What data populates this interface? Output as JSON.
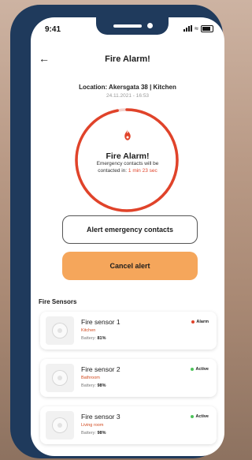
{
  "status_bar": {
    "time": "9:41"
  },
  "header": {
    "back_glyph": "←",
    "title": "Fire Alarm!"
  },
  "location": {
    "text": "Location: Akersgata 38 | Kitchen",
    "timestamp": "24.11.2021 - 16:53"
  },
  "alarm": {
    "title": "Fire Alarm!",
    "message": "Emergency contacts will be contacted in:",
    "countdown": "1 min 23 sec",
    "icon": "flame-icon",
    "progress_fraction": 0.97
  },
  "buttons": {
    "alert_label": "Alert emergency contacts",
    "cancel_label": "Cancel alert"
  },
  "sensors": {
    "section_title": "Fire Sensors",
    "battery_label": "Battery:",
    "items": [
      {
        "name": "Fire sensor 1",
        "room": "Kitchen",
        "battery": "81%",
        "status": "Alarm"
      },
      {
        "name": "Fire sensor 2",
        "room": "Bathroom",
        "battery": "98%",
        "status": "Active"
      },
      {
        "name": "Fire sensor 3",
        "room": "Living room",
        "battery": "98%",
        "status": "Active"
      }
    ]
  },
  "colors": {
    "accent_red": "#e0432a",
    "cancel_orange": "#f5a65b",
    "active_green": "#4cc35a",
    "frame_navy": "#1f3a5c"
  }
}
